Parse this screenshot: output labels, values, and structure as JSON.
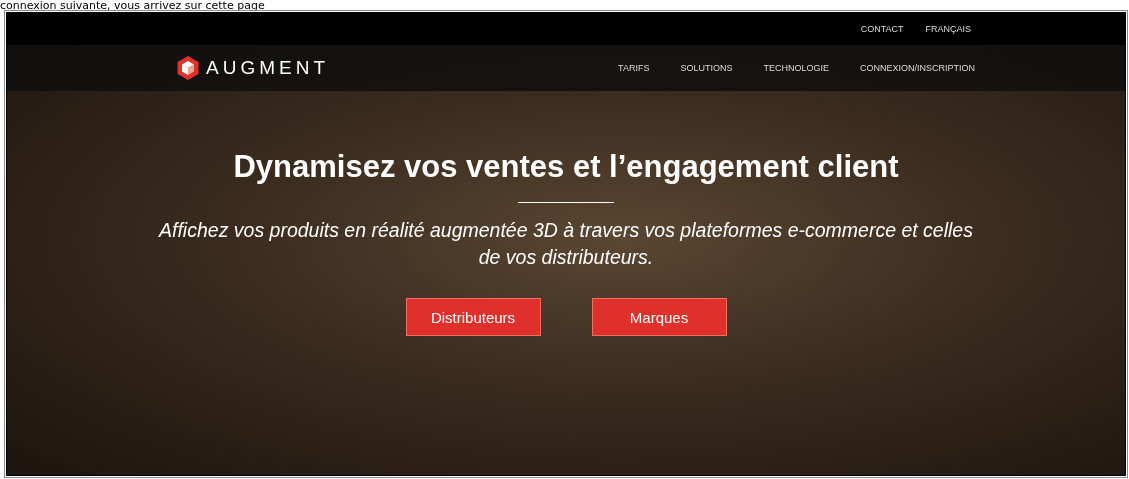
{
  "caption": "connexion suivante, vous arrivez sur cette page",
  "top_bar": {
    "links": [
      "CONTACT",
      "FRANÇAIS"
    ]
  },
  "nav": {
    "logo": "AUGMENT",
    "items": [
      "TARIFS",
      "SOLUTIONS",
      "TECHNOLOGIE",
      "CONNEXION/INSCRIPTION"
    ]
  },
  "hero": {
    "title": "Dynamisez vos ventes et l’engagement client",
    "subtitle": "Affichez vos produits en réalité augmentée 3D à travers vos plateformes e-commerce et celles de vos distributeurs.",
    "buttons": [
      "Distributeurs",
      "Marques"
    ]
  }
}
